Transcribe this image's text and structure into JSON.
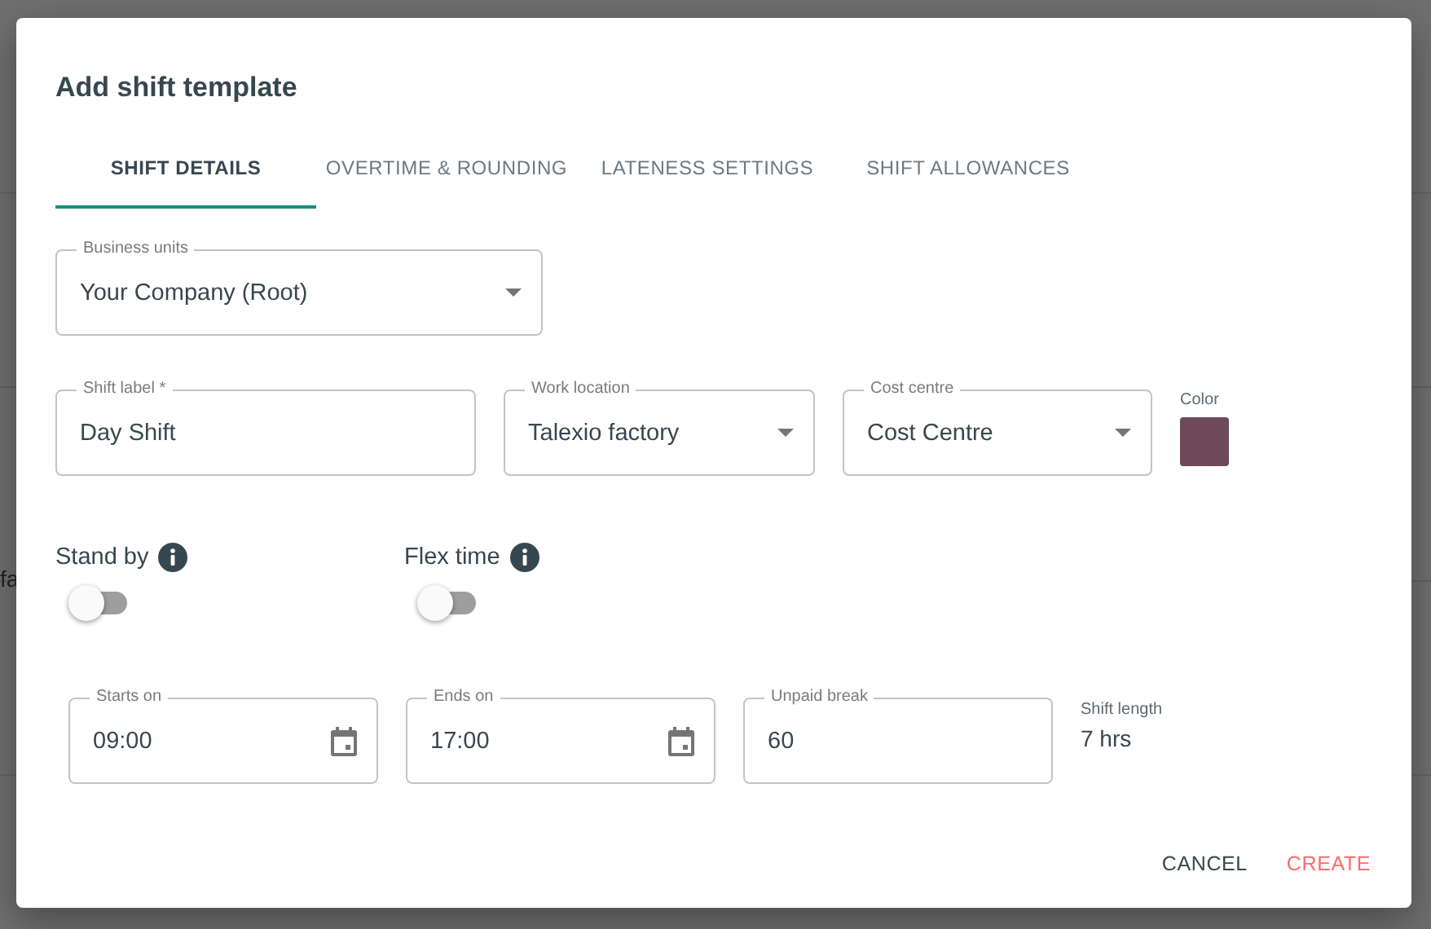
{
  "background": {
    "fragment": "fa"
  },
  "dialog": {
    "title": "Add shift template"
  },
  "tabs": [
    {
      "label": "SHIFT DETAILS",
      "selected": true
    },
    {
      "label": "OVERTIME & ROUNDING",
      "selected": false
    },
    {
      "label": "LATENESS SETTINGS",
      "selected": false
    },
    {
      "label": "SHIFT ALLOWANCES",
      "selected": false
    }
  ],
  "rows": [
    {
      "fields": [
        {
          "kind": "select",
          "label": "Business units",
          "value": "Your Company (Root)"
        }
      ]
    },
    {
      "fields": [
        {
          "kind": "text",
          "label": "Shift label *",
          "value": "Day Shift"
        },
        {
          "kind": "select",
          "label": "Work location",
          "value": "Talexio factory"
        },
        {
          "kind": "select",
          "label": "Cost centre",
          "value": "Cost Centre"
        },
        {
          "kind": "color",
          "label": "Color",
          "color": "#6e4a58"
        }
      ]
    }
  ],
  "toggles": [
    {
      "label": "Stand by",
      "on": false
    },
    {
      "label": "Flex time",
      "on": false
    }
  ],
  "times": {
    "fields": [
      {
        "kind": "time",
        "label": "Starts on",
        "value": "09:00"
      },
      {
        "kind": "time",
        "label": "Ends on",
        "value": "17:00"
      },
      {
        "kind": "text",
        "label": "Unpaid break",
        "value": "60"
      },
      {
        "kind": "readout",
        "label": "Shift length",
        "value": "7 hrs"
      }
    ]
  },
  "buttons": [
    {
      "label": "CANCEL",
      "kind": "secondary"
    },
    {
      "label": "CREATE",
      "kind": "primary"
    }
  ]
}
